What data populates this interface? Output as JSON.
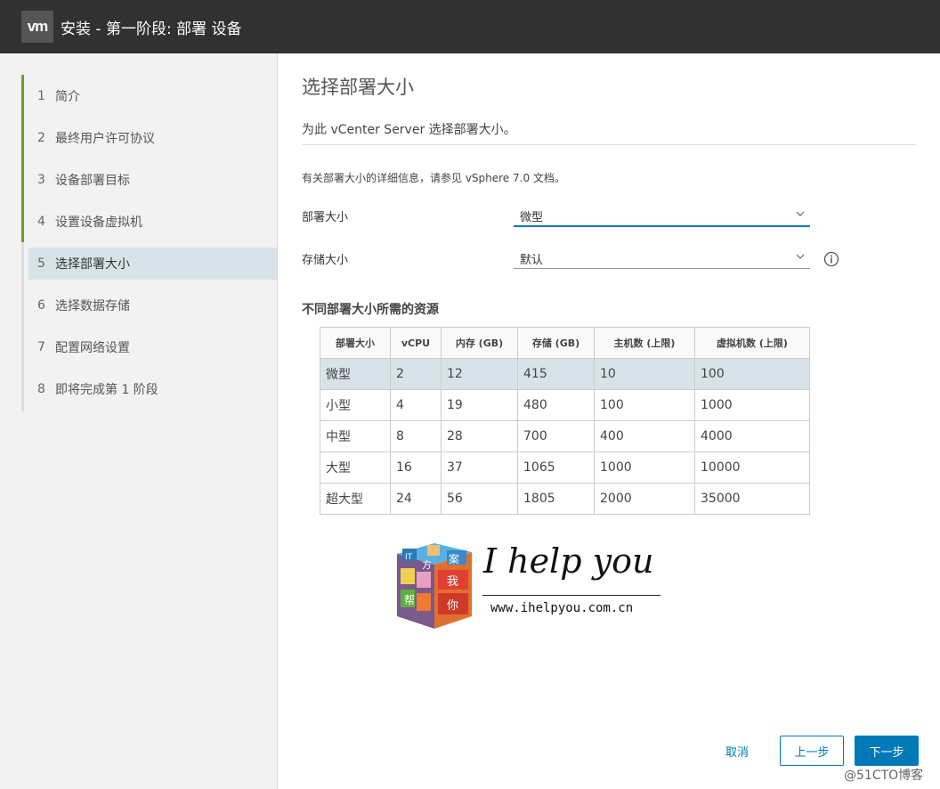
{
  "app": {
    "logo_text": "vm",
    "title": "安装 - 第一阶段: 部署 设备"
  },
  "sidebar": {
    "steps": [
      {
        "num": "1",
        "label": "简介"
      },
      {
        "num": "2",
        "label": "最终用户许可协议"
      },
      {
        "num": "3",
        "label": "设备部署目标"
      },
      {
        "num": "4",
        "label": "设置设备虚拟机"
      },
      {
        "num": "5",
        "label": "选择部署大小"
      },
      {
        "num": "6",
        "label": "选择数据存储"
      },
      {
        "num": "7",
        "label": "配置网络设置"
      },
      {
        "num": "8",
        "label": "即将完成第 1 阶段"
      }
    ],
    "active_step": 5,
    "done_color": "#62a420"
  },
  "main": {
    "title": "选择部署大小",
    "subtitle": "为此 vCenter Server 选择部署大小。",
    "info_text": "有关部署大小的详细信息，请参见 vSphere 7.0 文档。",
    "deployment_size": {
      "label": "部署大小",
      "value": "微型"
    },
    "storage_size": {
      "label": "存储大小",
      "value": "默认"
    },
    "section_title": "不同部署大小所需的资源",
    "table": {
      "headers": [
        "部署大小",
        "vCPU",
        "内存 (GB)",
        "存储 (GB)",
        "主机数 (上限)",
        "虚拟机数 (上限)"
      ],
      "rows": [
        [
          "微型",
          "2",
          "12",
          "415",
          "10",
          "100"
        ],
        [
          "小型",
          "4",
          "19",
          "480",
          "100",
          "1000"
        ],
        [
          "中型",
          "8",
          "28",
          "700",
          "400",
          "4000"
        ],
        [
          "大型",
          "16",
          "37",
          "1065",
          "1000",
          "10000"
        ],
        [
          "超大型",
          "24",
          "56",
          "1805",
          "2000",
          "35000"
        ]
      ],
      "selected_row": 0
    }
  },
  "watermark_logo": {
    "cube_chars": [
      "IT",
      "方",
      "案",
      "我",
      "帮",
      "你"
    ],
    "tagline": "I help you",
    "url": "www.ihelpyou.com.cn"
  },
  "footer": {
    "cancel": "取消",
    "back": "上一步",
    "next": "下一步"
  },
  "site_watermark": "@51CTO博客",
  "colors": {
    "accent": "#0079b8",
    "titlebar": "#313131",
    "selected_bg": "#d8e3e9"
  }
}
